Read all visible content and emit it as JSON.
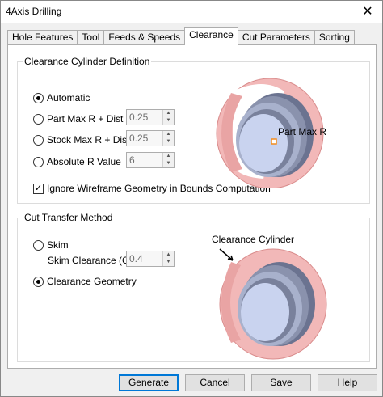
{
  "window": {
    "title": "4Axis Drilling",
    "close_glyph": "✕"
  },
  "tabs": [
    {
      "label": "Hole Features",
      "active": false
    },
    {
      "label": "Tool",
      "active": false
    },
    {
      "label": "Feeds & Speeds",
      "active": false
    },
    {
      "label": "Clearance",
      "active": true
    },
    {
      "label": "Cut Parameters",
      "active": false
    },
    {
      "label": "Sorting",
      "active": false
    }
  ],
  "clearance_cylinder": {
    "legend": "Clearance Cylinder Definition",
    "options": [
      {
        "label": "Automatic",
        "checked": true
      },
      {
        "label": "Part Max R + Dist",
        "checked": false,
        "value": "0.25"
      },
      {
        "label": "Stock Max R + Dist",
        "checked": false,
        "value": "0.25"
      },
      {
        "label": "Absolute R Value",
        "checked": false,
        "value": "6"
      }
    ],
    "ignore_wireframe": {
      "label": "Ignore Wireframe Geometry in Bounds Computation",
      "checked": true
    },
    "diagram_label": "Part Max R"
  },
  "cut_transfer": {
    "legend": "Cut Transfer Method",
    "skim": {
      "label": "Skim",
      "checked": false
    },
    "skim_clearance": {
      "label": "Skim Clearance (C)",
      "value": "0.4"
    },
    "clearance_geometry": {
      "label": "Clearance Geometry",
      "checked": true
    },
    "diagram_label": "Clearance Cylinder"
  },
  "buttons": {
    "generate": "Generate",
    "cancel": "Cancel",
    "save": "Save",
    "help": "Help"
  },
  "colors": {
    "cylinder_pink": "#f2b8b8",
    "cylinder_edge": "#d98c8c",
    "part_blue": "#c9d3ef",
    "part_dark": "#6b7390",
    "marker_orange": "#f28c1e",
    "default_button_border": "#0078d7"
  }
}
